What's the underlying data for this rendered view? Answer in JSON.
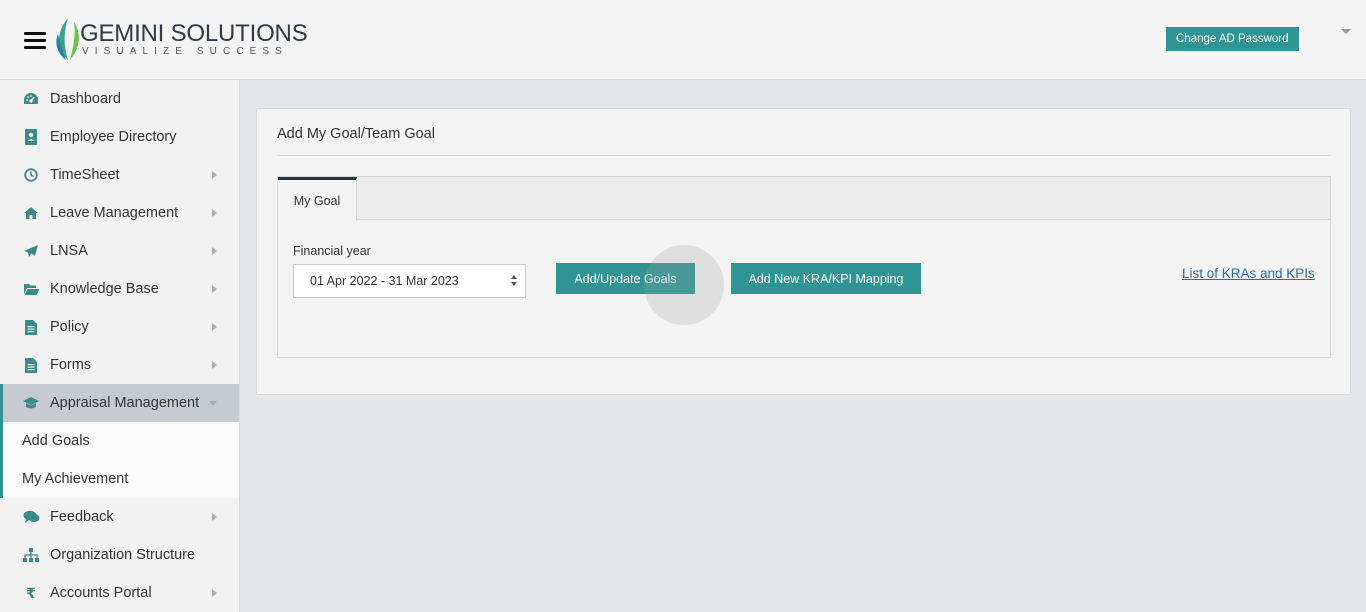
{
  "header": {
    "brand_name": "GEMINI SOLUTIONS",
    "brand_tagline": "VISUALIZE SUCCESS",
    "change_password_label": "Change AD Password",
    "menu_icon": "hamburger-icon",
    "user_menu_icon": "caret-down-icon"
  },
  "sidebar": {
    "items": [
      {
        "label": "Dashboard",
        "icon": "dashboard-icon",
        "has_submenu": false
      },
      {
        "label": "Employee Directory",
        "icon": "address-book-icon",
        "has_submenu": false
      },
      {
        "label": "TimeSheet",
        "icon": "clock-icon",
        "has_submenu": true
      },
      {
        "label": "Leave Management",
        "icon": "home-icon",
        "has_submenu": true
      },
      {
        "label": "LNSA",
        "icon": "paper-plane-icon",
        "has_submenu": true
      },
      {
        "label": "Knowledge Base",
        "icon": "folder-open-icon",
        "has_submenu": true
      },
      {
        "label": "Policy",
        "icon": "file-text-icon",
        "has_submenu": true
      },
      {
        "label": "Forms",
        "icon": "file-text-icon",
        "has_submenu": true
      },
      {
        "label": "Appraisal Management",
        "icon": "graduation-cap-icon",
        "has_submenu": true,
        "expanded": true
      },
      {
        "label": "Feedback",
        "icon": "comments-icon",
        "has_submenu": true
      },
      {
        "label": "Organization Structure",
        "icon": "sitemap-icon",
        "has_submenu": false
      },
      {
        "label": "Accounts Portal",
        "icon": "rupee-icon",
        "has_submenu": true
      }
    ],
    "appraisal_subitems": [
      {
        "label": "Add Goals"
      },
      {
        "label": "My Achievement"
      }
    ]
  },
  "main": {
    "title": "Add My Goal/Team Goal",
    "tabs": [
      {
        "label": "My Goal",
        "active": true
      }
    ],
    "financial_year_label": "Financial year",
    "financial_year_value": "01 Apr 2022 - 31 Mar 2023",
    "add_update_button": "Add/Update Goals",
    "add_kra_button": "Add New KRA/KPI Mapping",
    "kra_list_link": "List of KRAs and KPIs"
  },
  "colors": {
    "accent": "#2e9494",
    "link": "#2a6ea8",
    "active_nav": "#c5cbd1"
  }
}
